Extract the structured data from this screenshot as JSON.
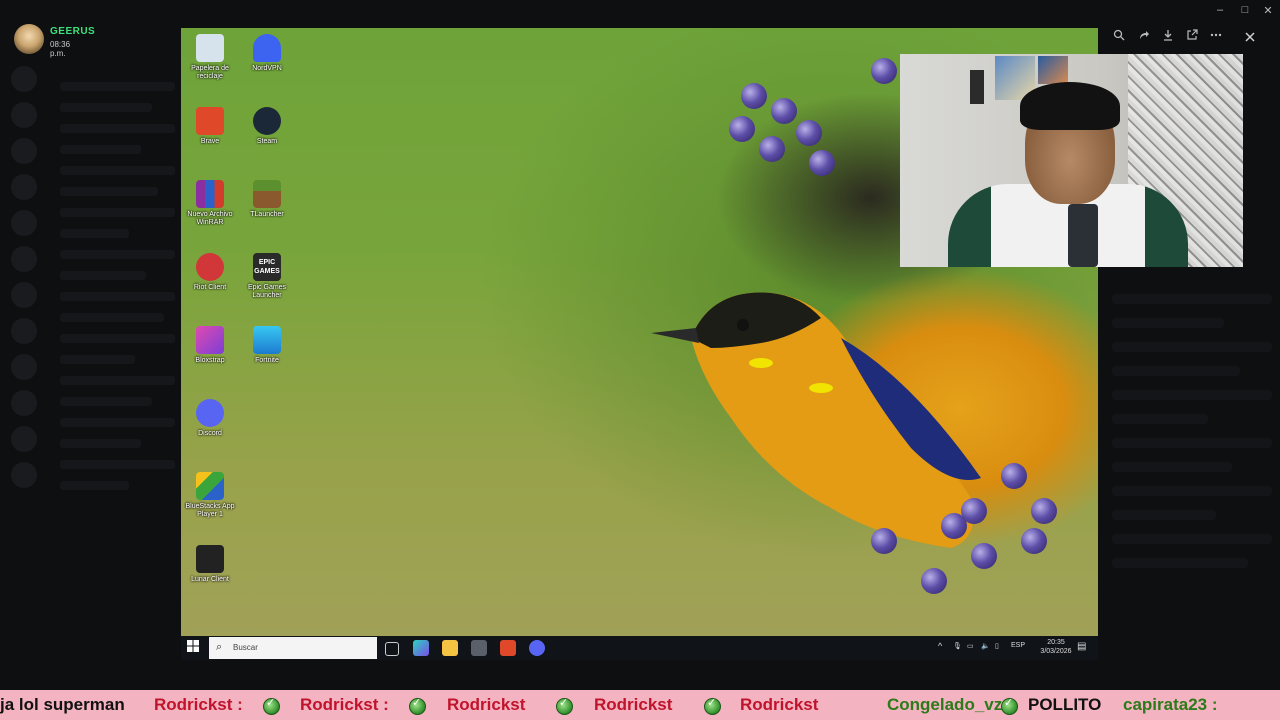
{
  "header": {
    "username": "GEERUS",
    "time": "08:36 p.m."
  },
  "window_controls": [
    "–",
    "□",
    "✕"
  ],
  "viewer_toolbar": {
    "zoom_icon": "zoom-icon",
    "forward_icon": "forward-icon",
    "download_icon": "download-icon",
    "open_external_icon": "open-external-icon",
    "more_icon": "more-icon",
    "close_icon": "close-icon"
  },
  "desktop": {
    "icons": [
      {
        "label": "Papelera de reciclaje",
        "color": "#9fb8c9"
      },
      {
        "label": "NordVPN",
        "color": "#3c64f0"
      },
      {
        "label": "Brave",
        "color": "#e0482a"
      },
      {
        "label": "Steam",
        "color": "#1b2838"
      },
      {
        "label": "Nuevo Archivo WinRAR",
        "color": "#8b2fa0"
      },
      {
        "label": "TLauncher",
        "color": "#5c8f2e"
      },
      {
        "label": "Riot Client",
        "color": "#d13639"
      },
      {
        "label": "Epic Games Launcher",
        "color": "#2a2a2a"
      },
      {
        "label": "Bloxstrap",
        "color": "#7b3fd6"
      },
      {
        "label": "Fortnite",
        "color": "#2db2e8"
      },
      {
        "label": "Discord",
        "color": "#5865f2"
      },
      {
        "label": "BlueStacks App Player 1",
        "color": "#3aa53a"
      },
      {
        "label": "Lunar Client",
        "color": "#222222"
      }
    ],
    "epic_text": "EPIC GAMES",
    "taskbar": {
      "search_placeholder": "Buscar",
      "language": "ESP",
      "clock_time": "20:35",
      "clock_date": "3/03/2026"
    }
  },
  "ticker": {
    "items": [
      {
        "type": "msg",
        "text": "ja lol superman"
      },
      {
        "type": "user",
        "text": "Rodrickst :"
      },
      {
        "type": "user",
        "text": "Rodrickst :"
      },
      {
        "type": "user",
        "text": "Rodrickst"
      },
      {
        "type": "user",
        "text": "Rodrickst"
      },
      {
        "type": "user",
        "text": "Rodrickst"
      },
      {
        "type": "user2",
        "text": "Congelado_vz :"
      },
      {
        "type": "msg",
        "text": "POLLITO"
      },
      {
        "type": "user2",
        "text": "capirata23 :"
      }
    ]
  }
}
